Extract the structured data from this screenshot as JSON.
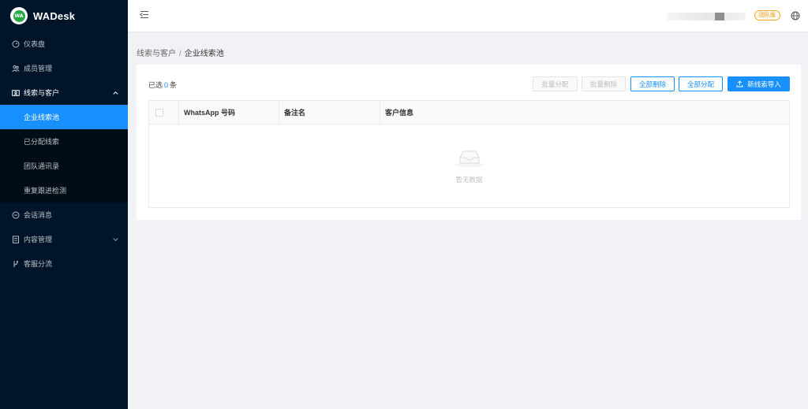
{
  "app": {
    "title": "WADesk",
    "logo_text": "WA"
  },
  "sidebar": {
    "items": [
      {
        "label": "仪表盘",
        "icon": "dashboard-icon"
      },
      {
        "label": "成员管理",
        "icon": "team-icon"
      },
      {
        "label": "线索与客户",
        "icon": "contacts-icon",
        "expanded": true,
        "children": [
          {
            "label": "企业线索池",
            "active": true
          },
          {
            "label": "已分配线索"
          },
          {
            "label": "团队通讯录"
          },
          {
            "label": "重复跟进检测"
          }
        ]
      },
      {
        "label": "会话消息",
        "icon": "chat-icon"
      },
      {
        "label": "内容管理",
        "icon": "content-icon",
        "expandable": true
      },
      {
        "label": "客服分流",
        "icon": "branch-icon"
      }
    ]
  },
  "header": {
    "badge": "团队版"
  },
  "breadcrumb": {
    "parent": "线索与客户",
    "separator": "/",
    "current": "企业线索池"
  },
  "toolbar": {
    "selected_prefix": "已选",
    "selected_count": "0",
    "selected_suffix": "条",
    "batch_assign": "批量分配",
    "batch_delete": "批量删除",
    "delete_all": "全部删除",
    "assign_all": "全部分配",
    "import_new": "新线索导入"
  },
  "table": {
    "columns": [
      "WhatsApp 号码",
      "备注名",
      "客户信息"
    ],
    "rows": [],
    "empty_text": "暂无数据"
  },
  "colors": {
    "sidebar_bg": "#001529",
    "submenu_bg": "#000c17",
    "accent": "#1890ff",
    "badge": "#f5a623"
  }
}
